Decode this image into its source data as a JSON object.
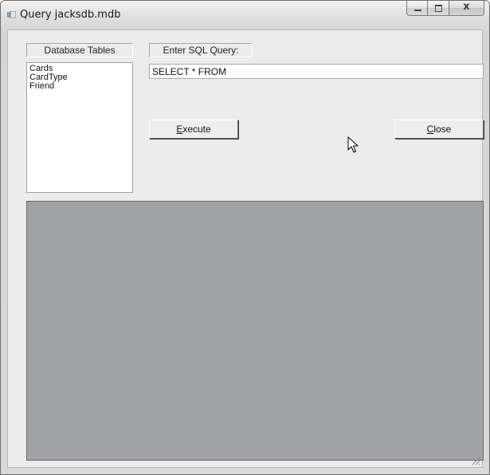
{
  "window": {
    "title": "Query jacksdb.mdb"
  },
  "tables_panel": {
    "label": "Database Tables",
    "items": [
      "Cards",
      "CardType",
      "Friend"
    ]
  },
  "query_panel": {
    "label": "Enter SQL Query:",
    "query_value": "SELECT * FROM"
  },
  "buttons": {
    "execute": {
      "mnemonic": "E",
      "rest": "xecute"
    },
    "close": {
      "mnemonic": "C",
      "rest": "lose"
    }
  },
  "icons": {
    "app": "app-window-icon",
    "minimize": "minimize-icon",
    "maximize": "maximize-icon",
    "close": "close-icon",
    "cursor": "mouse-pointer-icon",
    "size_grip": "size-grip-icon"
  },
  "colors": {
    "grid_background": "#a1a3a6",
    "form_background": "#ececec"
  }
}
